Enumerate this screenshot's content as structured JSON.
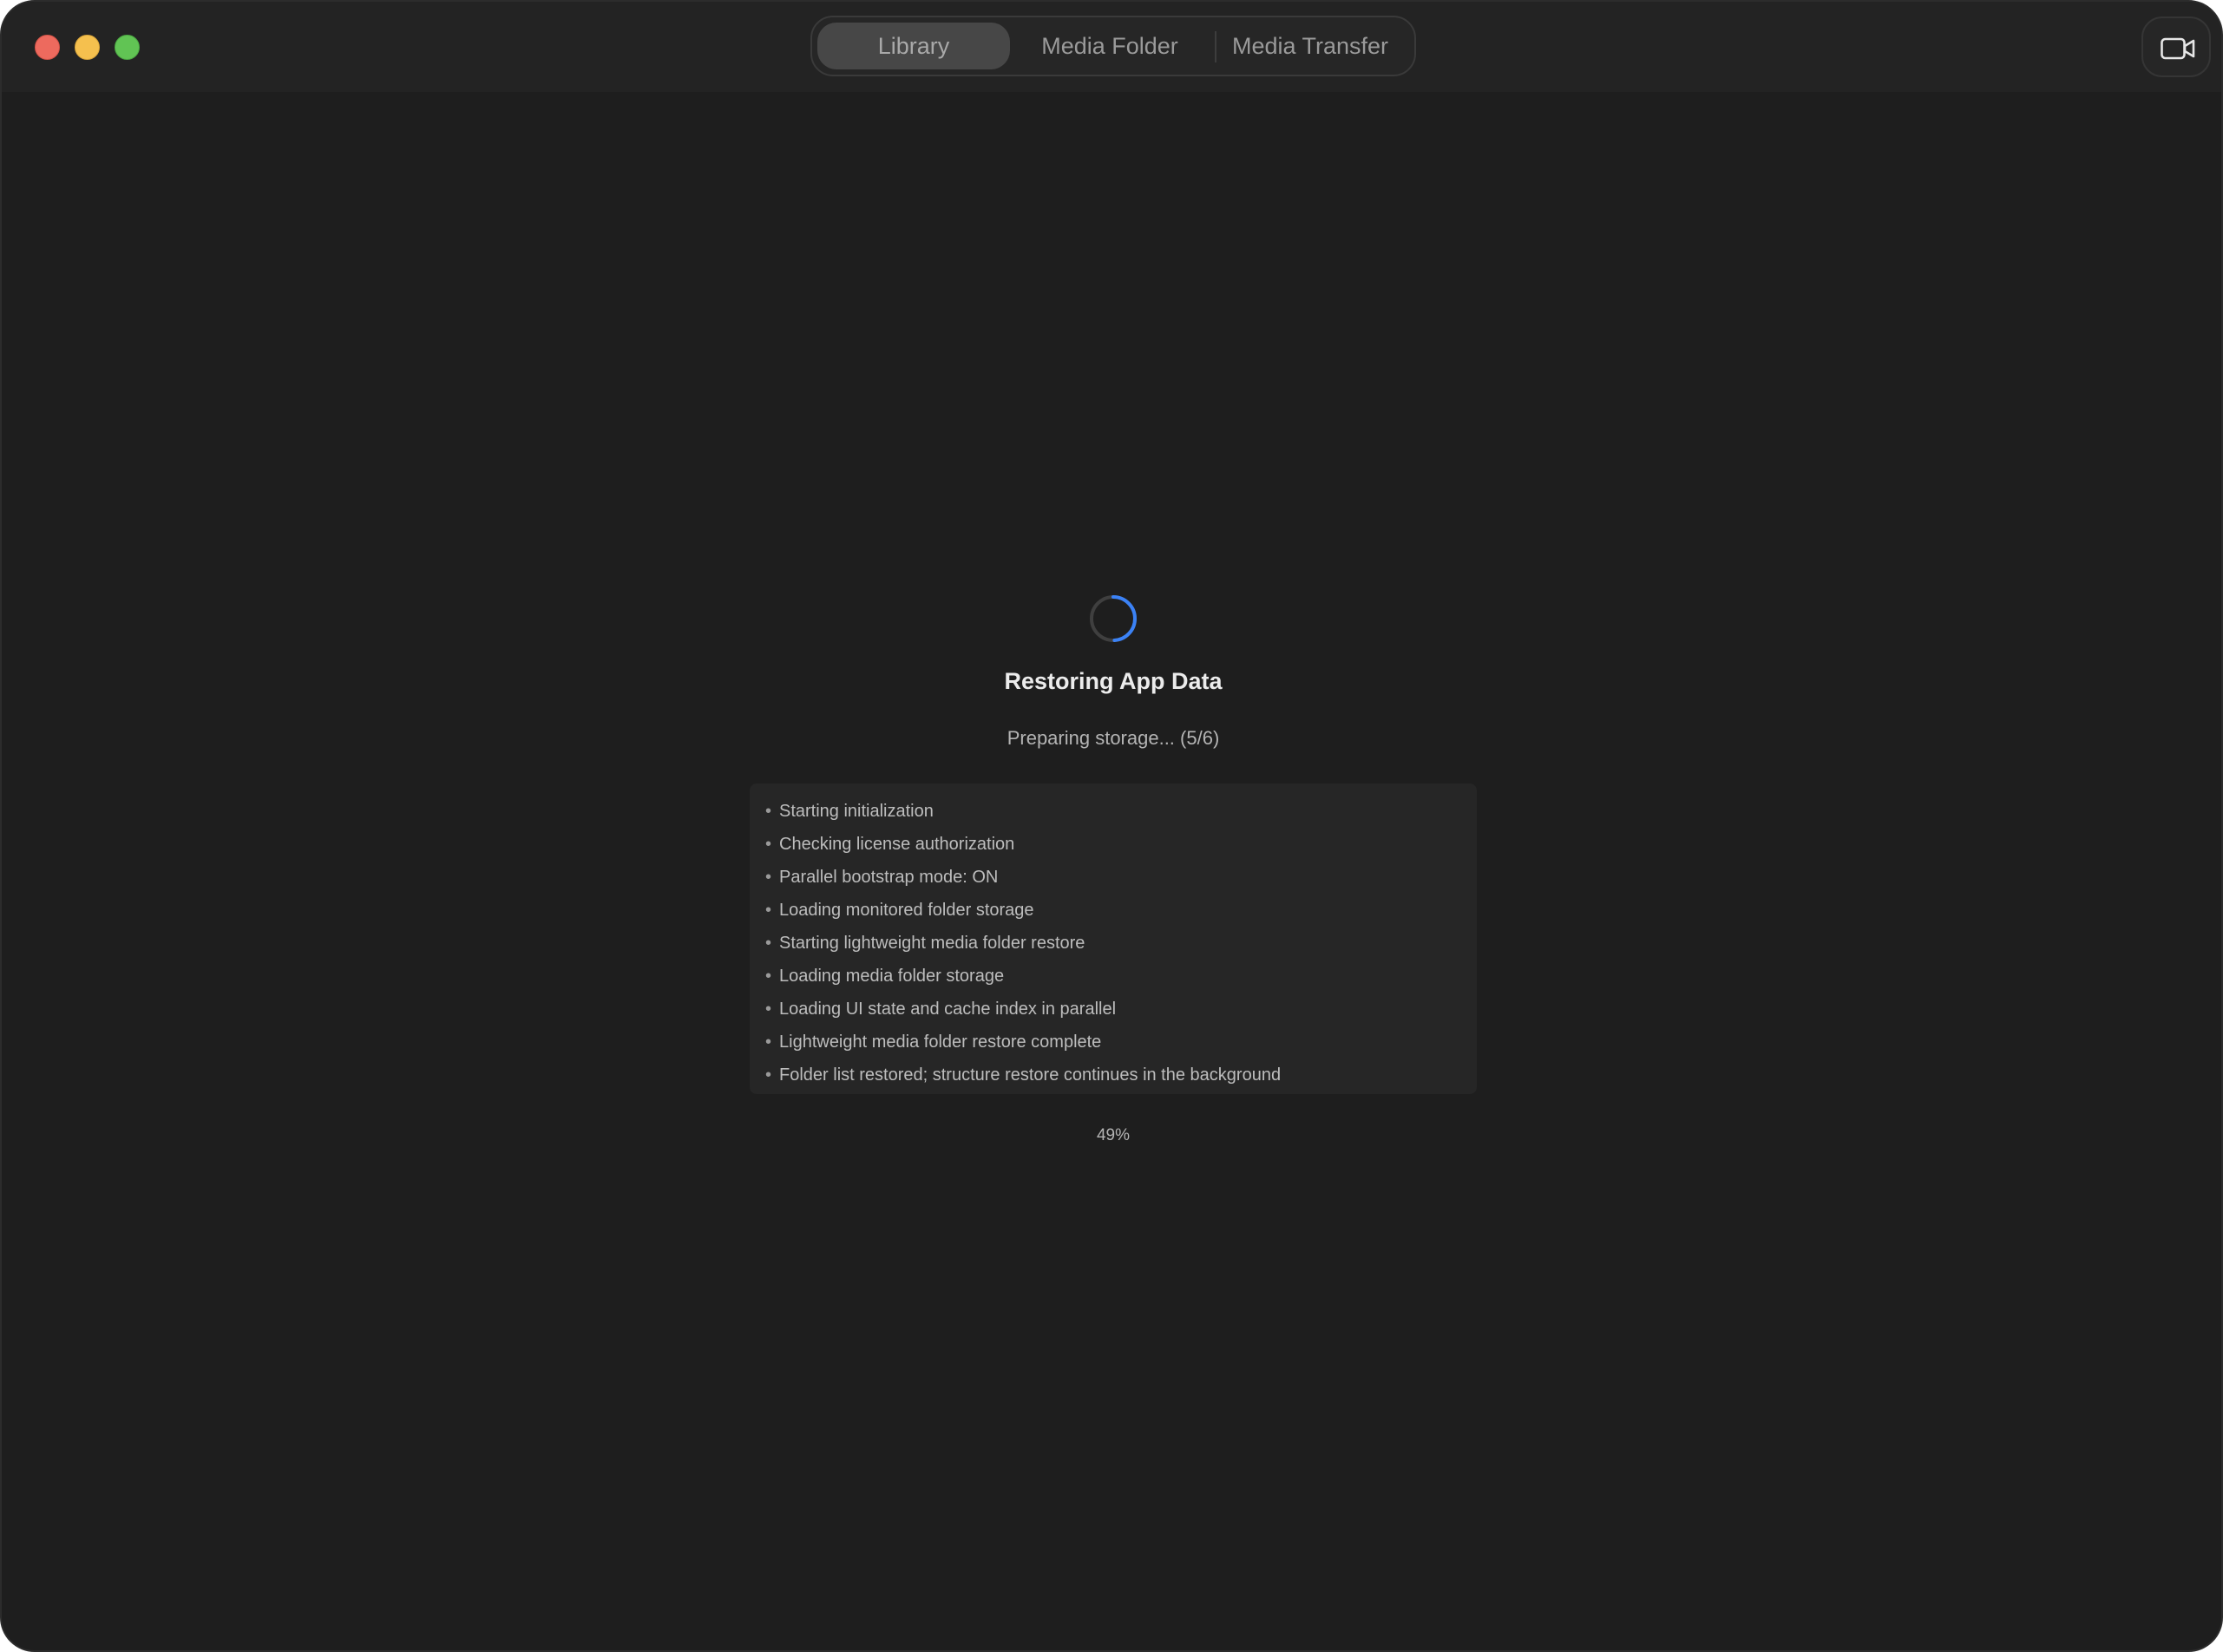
{
  "toolbar": {
    "tabs": [
      {
        "label": "Library",
        "active": true
      },
      {
        "label": "Media Folder",
        "active": false
      },
      {
        "label": "Media Transfer",
        "active": false
      }
    ],
    "right_button_icon": "video-camera-icon"
  },
  "loading": {
    "title": "Restoring App Data",
    "status": "Preparing storage... (5/6)",
    "log": [
      "Starting initialization",
      "Checking license authorization",
      "Parallel bootstrap mode: ON",
      "Loading monitored folder storage",
      "Starting lightweight media folder restore",
      "Loading media folder storage",
      "Loading UI state and cache index in parallel",
      "Lightweight media folder restore complete",
      "Folder list restored; structure restore continues in the background"
    ],
    "progress_label": "49%",
    "progress_value": 0.49,
    "spinner_icon": "loading-spinner-icon"
  },
  "colors": {
    "accent": "#3b82f6",
    "background": "#1e1e1e",
    "close": "#ed6a5e",
    "minimize": "#f5c04e",
    "zoom": "#61c454"
  }
}
